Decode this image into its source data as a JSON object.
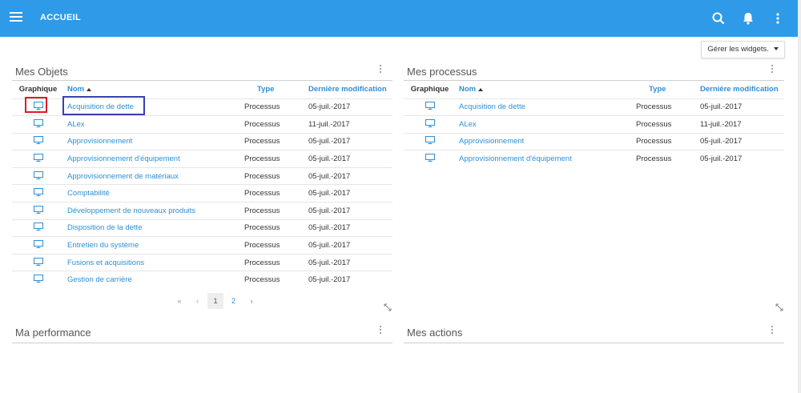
{
  "header": {
    "title": "ACCUEIL",
    "menu_icon": "menu-icon",
    "search_icon": "search-icon",
    "bell_icon": "bell-icon",
    "more_icon": "more-vertical-icon",
    "color": "#2e9ae8"
  },
  "manage_widgets": {
    "label": "Gérer les widgets."
  },
  "objets": {
    "title": "Mes Objets",
    "columns": {
      "graphic": "Graphique",
      "name": "Nom",
      "type": "Type",
      "modified": "Dernière modification"
    },
    "rows": [
      {
        "name": "Acquisition de dette",
        "type": "Processus",
        "date": "05-juil.-2017"
      },
      {
        "name": "ALex",
        "type": "Processus",
        "date": "11-juil.-2017"
      },
      {
        "name": "Approvisionnement",
        "type": "Processus",
        "date": "05-juil.-2017"
      },
      {
        "name": "Approvisionnement d'équipement",
        "type": "Processus",
        "date": "05-juil.-2017"
      },
      {
        "name": "Approvisionnement de matériaux",
        "type": "Processus",
        "date": "05-juil.-2017"
      },
      {
        "name": "Comptabilité",
        "type": "Processus",
        "date": "05-juil.-2017"
      },
      {
        "name": "Développement de nouveaux produits",
        "type": "Processus",
        "date": "05-juil.-2017"
      },
      {
        "name": "Disposition de la dette",
        "type": "Processus",
        "date": "05-juil.-2017"
      },
      {
        "name": "Entretien du système",
        "type": "Processus",
        "date": "05-juil.-2017"
      },
      {
        "name": "Fusions et acquisitions",
        "type": "Processus",
        "date": "05-juil.-2017"
      },
      {
        "name": "Gestion de carrière",
        "type": "Processus",
        "date": "05-juil.-2017"
      }
    ],
    "pager": {
      "first": "«",
      "prev": "‹",
      "page1": "1",
      "page2": "2",
      "next": "›"
    }
  },
  "processus": {
    "title": "Mes processus",
    "columns": {
      "graphic": "Graphique",
      "name": "Nom",
      "type": "Type",
      "modified": "Dernière modification"
    },
    "rows": [
      {
        "name": "Acquisition de dette",
        "type": "Processus",
        "date": "05-juil.-2017"
      },
      {
        "name": "ALex",
        "type": "Processus",
        "date": "11-juil.-2017"
      },
      {
        "name": "Approvisionnement",
        "type": "Processus",
        "date": "05-juil.-2017"
      },
      {
        "name": "Approvisionnement d'équipement",
        "type": "Processus",
        "date": "05-juil.-2017"
      }
    ]
  },
  "performance": {
    "title": "Ma performance"
  },
  "actions": {
    "title": "Mes actions"
  },
  "colors": {
    "link": "#2e8fd6",
    "highlight_red": "#e0182b",
    "highlight_blue": "#3a3fb0"
  }
}
